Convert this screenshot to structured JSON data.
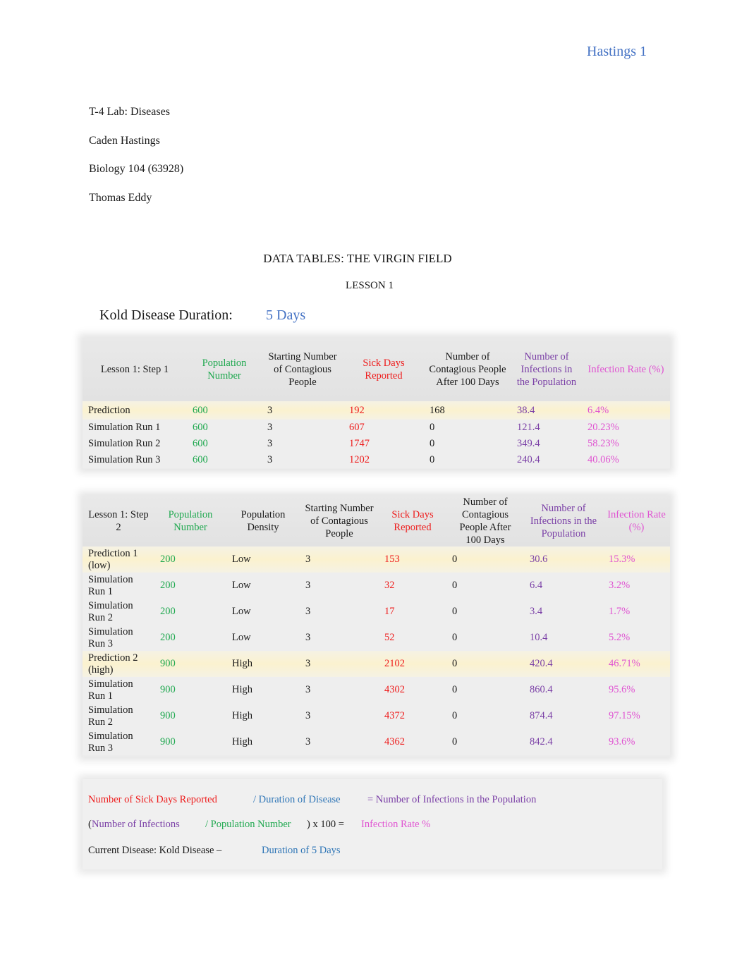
{
  "header": {
    "running_head": "Hastings 1"
  },
  "meta": {
    "course_title": "T-4 Lab: Diseases",
    "student": "Caden Hastings",
    "course": "Biology 104 (63928)",
    "instructor": "Thomas Eddy"
  },
  "title": "DATA TABLES: THE VIRGIN FIELD",
  "lesson": "LESSON 1",
  "disease_duration": {
    "label": "Kold Disease Duration:",
    "value": "5 Days"
  },
  "colors": {
    "population": "#1fa84f",
    "sick_days": "#ee1c1c",
    "infections": "#7a3fa6",
    "infection_rate": "#e054d2",
    "duration": "#2e75b6",
    "prediction_highlight": "#fbf2cf"
  },
  "table1": {
    "headers": [
      "Lesson 1: Step 1",
      "Population Number",
      "Starting Number of Contagious People",
      "Sick Days Reported",
      "Number of Contagious People After 100 Days",
      "Number of Infections in the Population",
      "Infection Rate (%)"
    ],
    "rows": [
      {
        "label": "Prediction",
        "population": "600",
        "starting": "3",
        "sick_days": "192",
        "after_100": "168",
        "infections": "38.4",
        "rate": "6.4%"
      },
      {
        "label": "Simulation Run 1",
        "population": "600",
        "starting": "3",
        "sick_days": "607",
        "after_100": "0",
        "infections": "121.4",
        "rate": "20.23%"
      },
      {
        "label": "Simulation Run 2",
        "population": "600",
        "starting": "3",
        "sick_days": "1747",
        "after_100": "0",
        "infections": "349.4",
        "rate": "58.23%"
      },
      {
        "label": "Simulation Run 3",
        "population": "600",
        "starting": "3",
        "sick_days": "1202",
        "after_100": "0",
        "infections": "240.4",
        "rate": "40.06%"
      }
    ]
  },
  "table2": {
    "headers": [
      "Lesson 1: Step 2",
      "Population Number",
      "Population Density",
      "Starting Number of Contagious People",
      "Sick Days Reported",
      "Number of Contagious People After 100 Days",
      "Number of Infections in the Population",
      "Infection Rate (%)"
    ],
    "rows": [
      {
        "label": "Prediction 1 (low)",
        "population": "200",
        "density": "Low",
        "starting": "3",
        "sick_days": "153",
        "after_100": "0",
        "infections": "30.6",
        "rate": "15.3%"
      },
      {
        "label": "Simulation Run 1",
        "population": "200",
        "density": "Low",
        "starting": "3",
        "sick_days": "32",
        "after_100": "0",
        "infections": "6.4",
        "rate": "3.2%"
      },
      {
        "label": "Simulation Run 2",
        "population": "200",
        "density": "Low",
        "starting": "3",
        "sick_days": "17",
        "after_100": "0",
        "infections": "3.4",
        "rate": "1.7%"
      },
      {
        "label": "Simulation Run 3",
        "population": "200",
        "density": "Low",
        "starting": "3",
        "sick_days": "52",
        "after_100": "0",
        "infections": "10.4",
        "rate": "5.2%"
      },
      {
        "label": "Prediction 2 (high)",
        "population": "900",
        "density": "High",
        "starting": "3",
        "sick_days": "2102",
        "after_100": "0",
        "infections": "420.4",
        "rate": "46.71%"
      },
      {
        "label": "Simulation Run 1",
        "population": "900",
        "density": "High",
        "starting": "3",
        "sick_days": "4302",
        "after_100": "0",
        "infections": "860.4",
        "rate": "95.6%"
      },
      {
        "label": "Simulation Run 2",
        "population": "900",
        "density": "High",
        "starting": "3",
        "sick_days": "4372",
        "after_100": "0",
        "infections": "874.4",
        "rate": "97.15%"
      },
      {
        "label": "Simulation Run 3",
        "population": "900",
        "density": "High",
        "starting": "3",
        "sick_days": "4362",
        "after_100": "0",
        "infections": "842.4",
        "rate": "93.6%"
      }
    ]
  },
  "formulas": {
    "line1": {
      "a": "Number of Sick Days Reported",
      "b": "/ Duration of Disease",
      "c": "= Number of Infections in the Population"
    },
    "line2": {
      "open": "(",
      "a": "Number of Infections",
      "b": "/ Population Number",
      "op": ") x 100 =",
      "c": "Infection Rate %"
    },
    "line3": {
      "a": "Current Disease: Kold Disease –",
      "b": "Duration of 5 Days"
    }
  }
}
